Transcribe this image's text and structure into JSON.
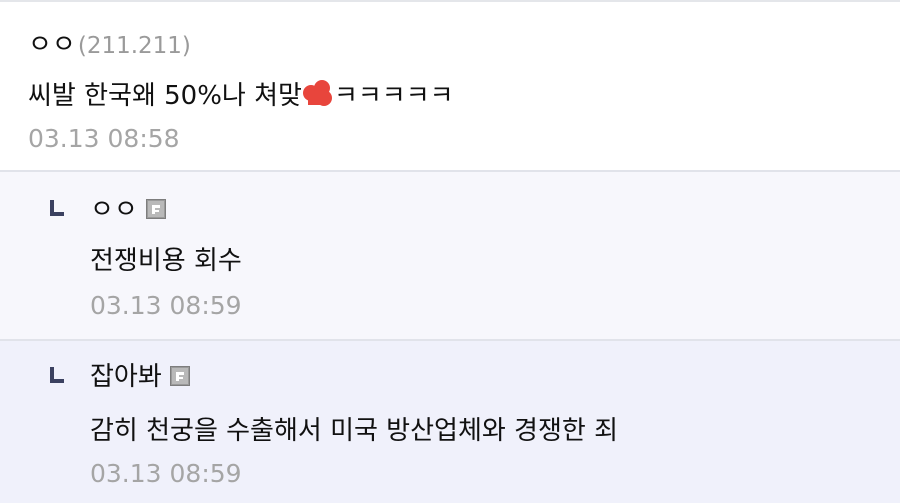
{
  "comments": [
    {
      "nickname": "ㅇㅇ",
      "ip": "(211.211)",
      "text_before": "씨발 한국왜 50%나 쳐맞",
      "text_after": "ㅋㅋㅋㅋㅋ",
      "time": "03.13 08:58"
    }
  ],
  "replies": [
    {
      "nickname": "ㅇㅇ",
      "text": "전쟁비용 회수",
      "time": "03.13 08:59",
      "icon": "fixed-nick-icon"
    },
    {
      "nickname": "잡아봐",
      "text": "감히 천궁을 수출해서 미국 방산업체와 경쟁한 죄",
      "time": "03.13 08:59",
      "icon": "fixed-nick-icon"
    }
  ],
  "colors": {
    "text": "#111111",
    "meta": "#a5a5a5",
    "reply_bg_1": "#f7f7fc",
    "reply_bg_2": "#f0f1fb",
    "reply_arrow": "#3b4160",
    "emoji": "#e8453c"
  }
}
